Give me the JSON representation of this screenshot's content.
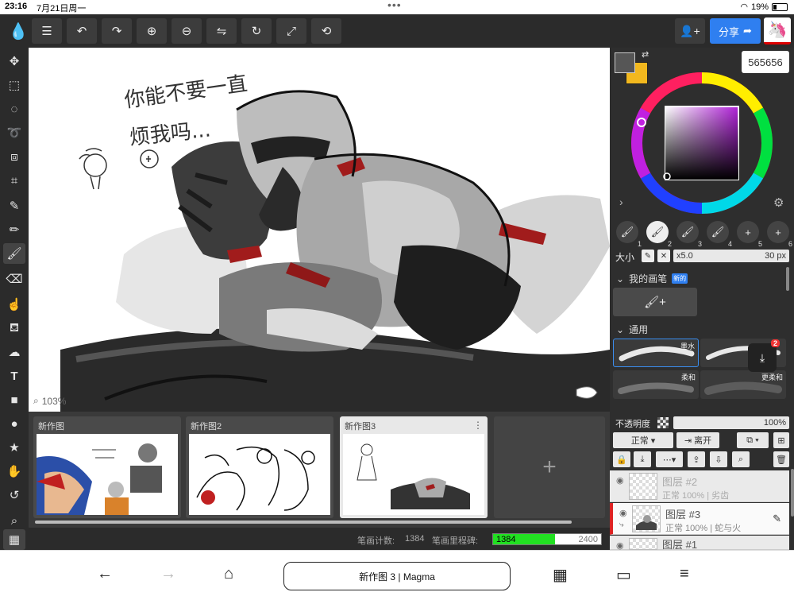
{
  "status_bar": {
    "time": "23:16",
    "date": "7月21日周一",
    "battery": "19%"
  },
  "toolbar": {
    "share_label": "分享"
  },
  "canvas": {
    "zoom": "103%",
    "handwriting_lines": [
      "你能不要一直",
      "烦我吗..."
    ]
  },
  "gallery": {
    "items": [
      {
        "title": "新作图"
      },
      {
        "title": "新作图2"
      },
      {
        "title": "新作图3"
      }
    ],
    "add_symbol": "+"
  },
  "stroke_counter": {
    "count_label": "笔画计数:",
    "count": "1384",
    "mileage_label": "笔画里程碑:",
    "progress_value": "1384",
    "progress_max": "2400",
    "progress_fraction": 0.577
  },
  "color": {
    "hex": "565656",
    "foreground": "#565656",
    "background": "#f2b81e"
  },
  "brush_presets": [
    "1",
    "2",
    "3",
    "4",
    "5",
    "6"
  ],
  "brush_size": {
    "label": "大小",
    "multiplier": "x5.0",
    "value": "30 px"
  },
  "brush_library": {
    "my_brushes_label": "我的画笔",
    "new_badge": "新的",
    "general_label": "通用",
    "brushes": [
      {
        "name": "墨水"
      },
      {
        "name": ""
      },
      {
        "name": "柔和"
      },
      {
        "name": "更柔和"
      }
    ],
    "download_badge": "2"
  },
  "layers": {
    "opacity_label": "不透明度",
    "opacity_value": "100%",
    "blend_mode": "正常",
    "leave_label": "离开",
    "items": [
      {
        "name": "图层 #2",
        "info": "正常 100% | 劣齿"
      },
      {
        "name": "图层 #3",
        "info": "正常 100% | 蛇与火"
      },
      {
        "name": "图层 #1",
        "info": ""
      }
    ]
  },
  "browser": {
    "url_title": "新作图 3 | Magma"
  }
}
